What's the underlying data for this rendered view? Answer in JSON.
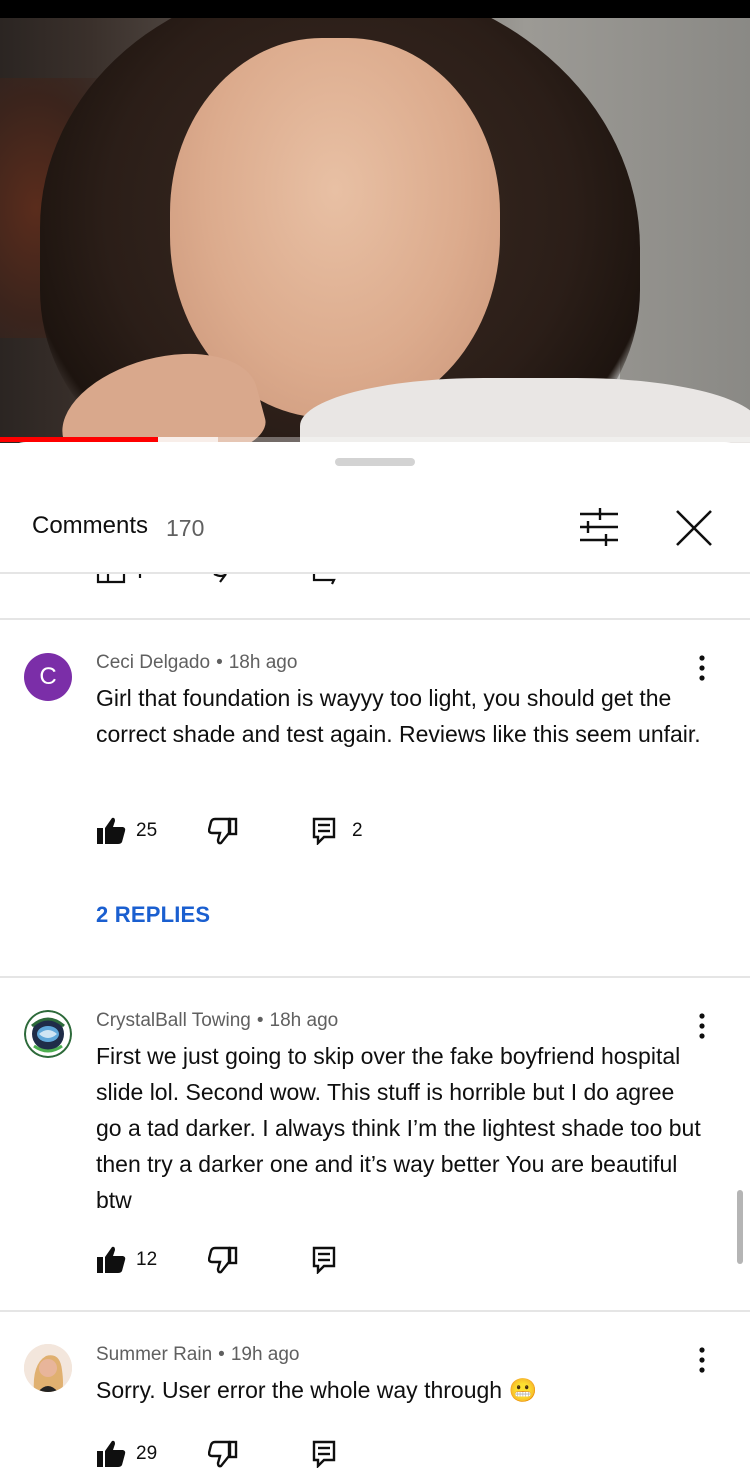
{
  "video": {
    "progress_fraction": 0.21,
    "buffer_fraction": 0.29
  },
  "comments_sheet": {
    "title": "Comments",
    "count": "170"
  },
  "comments": [
    {
      "author": "Ceci Delgado",
      "time": "18h ago",
      "avatar_letter": "C",
      "text": "Girl that foundation is wayyy too light, you should get the correct shade and test again. Reviews like this seem unfair.",
      "likes": "25",
      "reply_count": "2",
      "replies_label": "2 REPLIES"
    },
    {
      "author": "CrystalBall Towing",
      "time": "18h ago",
      "text": "First we just going to skip over the fake boyfriend hospital slide lol. Second wow. This stuff is horrible  but I do agree go a tad darker. I always think I’m the lightest shade too but then try a darker one and it’s way better You are beautiful btw",
      "likes": "12"
    },
    {
      "author": "Summer Rain",
      "time": "19h ago",
      "text": "Sorry. User error the whole way through 😬",
      "likes": "29"
    }
  ],
  "colors": {
    "accent_link": "#1a5fd0",
    "progress": "#ff0000",
    "avatar_c": "#7b2ea8",
    "meta_text": "#606060"
  },
  "icons": {
    "filter": "sliders-icon",
    "close": "close-icon",
    "like": "thumbs-up-icon",
    "dislike": "thumbs-down-icon",
    "reply": "reply-icon",
    "more": "more-vert-icon"
  }
}
